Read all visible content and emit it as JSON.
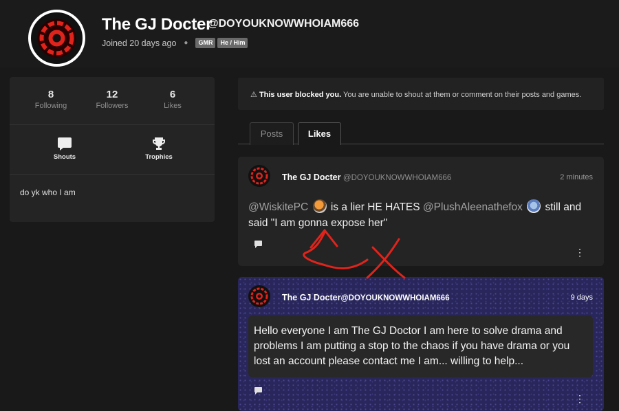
{
  "profile": {
    "name": "The GJ Docter",
    "handle": "@DOYOUKNOWWHOIAM666",
    "joined": "Joined 20 days ago",
    "tags": [
      "GMR",
      "He / Him"
    ]
  },
  "stats": [
    {
      "value": "8",
      "label": "Following"
    },
    {
      "value": "12",
      "label": "Followers"
    },
    {
      "value": "6",
      "label": "Likes"
    }
  ],
  "links": {
    "shouts": "Shouts",
    "trophies": "Trophies"
  },
  "bio": "do yk who I am",
  "notice": {
    "bold": "This user blocked you.",
    "text": " You are unable to shout at them or comment on their posts and games."
  },
  "tabs": {
    "posts": "Posts",
    "likes": "Likes"
  },
  "posts": [
    {
      "author": "The GJ Docter",
      "handle": "@DOYOUKNOWWHOIAM666",
      "time": "2 minutes",
      "parts": {
        "m1": "@WiskitePC",
        "t1": " is a lier HE HATES ",
        "m2": "@PlushAleenathefox",
        "t2": " still and said \"I am gonna expose her\""
      }
    },
    {
      "author": "The GJ Docter",
      "handle": "@DOYOUKNOWWHOIAM666",
      "time": "9 days",
      "body": "Hello everyone I am The GJ Doctor I am here to solve drama and problems I am putting a stop to the chaos if you have drama or you lost an account please contact me I am... willing to help..."
    }
  ],
  "colors": {
    "accent_red": "#e0241c",
    "post2_bg": "#28265a"
  }
}
